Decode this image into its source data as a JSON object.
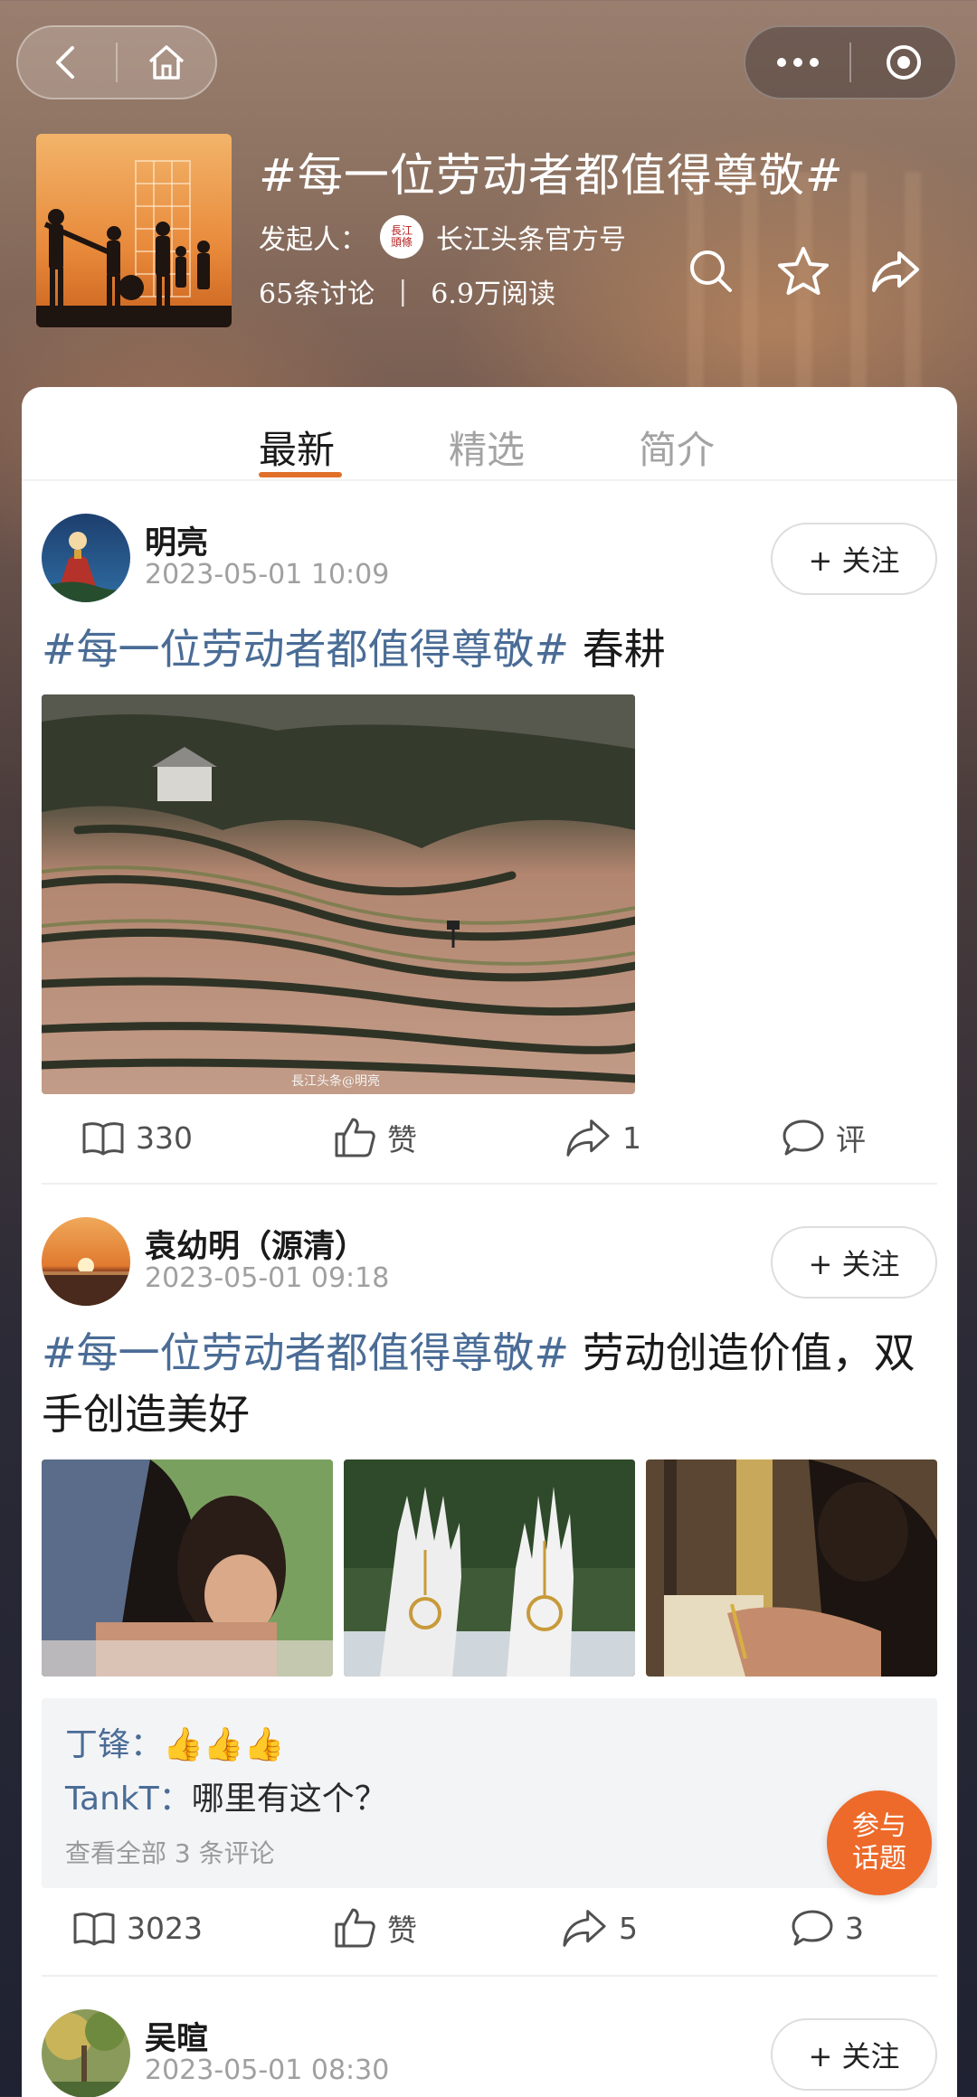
{
  "header": {
    "title": "#每一位劳动者都值得尊敬#",
    "initiator_label": "发起人：",
    "initiator_name": "长江头条官方号",
    "logo_text": "長江頭條",
    "discussions": "65条讨论",
    "stats_sep": "|",
    "reads": "6.9万阅读"
  },
  "tabs": [
    {
      "label": "最新",
      "active": true
    },
    {
      "label": "精选",
      "active": false
    },
    {
      "label": "简介",
      "active": false
    }
  ],
  "posts": [
    {
      "author": "明亮",
      "time": "2023-05-01 10:09",
      "follow": "+ 关注",
      "hashtag": "#每一位劳动者都值得尊敬#",
      "text": " 春耕",
      "watermark": "長江头条@明亮",
      "reads": "330",
      "like": "赞",
      "shares": "1",
      "comments": "评"
    },
    {
      "author": "袁幼明（源清）",
      "time": "2023-05-01 09:18",
      "follow": "+ 关注",
      "hashtag": "#每一位劳动者都值得尊敬#",
      "text": " 劳动创造价值，双",
      "text_line2": "手创造美好",
      "comment_list": [
        {
          "name": "丁锋：",
          "body": "👍👍👍"
        },
        {
          "name": "TankT：",
          "body": "哪里有这个？"
        }
      ],
      "view_all": "查看全部 3 条评论",
      "reads": "3023",
      "like": "赞",
      "shares": "5",
      "comments": "3"
    },
    {
      "author": "吴暄",
      "time": "2023-05-01 08:30",
      "follow": "+ 关注"
    }
  ],
  "join_button": {
    "line1": "参与",
    "line2": "话题"
  },
  "colors": {
    "accent": "#e0702a",
    "hashtag": "#4a6c96",
    "join": "#ed6a2a"
  }
}
